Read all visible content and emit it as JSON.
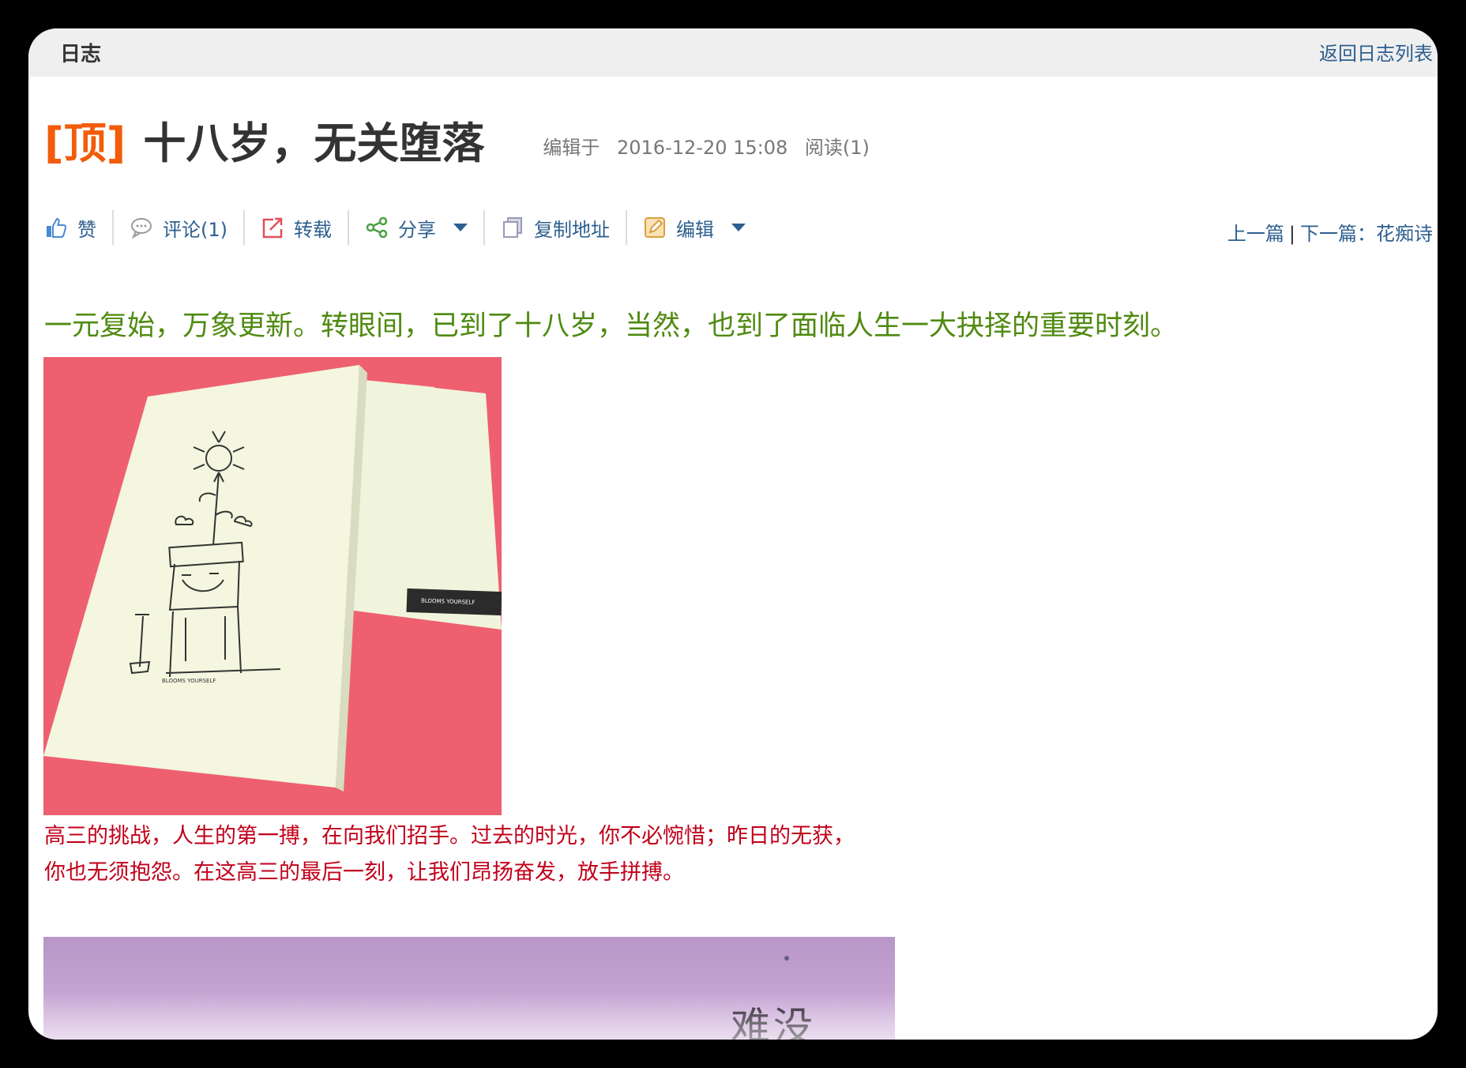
{
  "topbar": {
    "title": "日志",
    "back_link": "返回日志列表"
  },
  "post": {
    "top_tag": "[顶]",
    "title": "十八岁，无关堕落",
    "edited_label": "编辑于",
    "datetime": "2016-12-20 15:08",
    "reads": "阅读(1)"
  },
  "toolbar": {
    "like": "赞",
    "comment": "评论(1)",
    "repost": "转载",
    "share": "分享",
    "copy_link": "复制地址",
    "edit": "编辑"
  },
  "nav": {
    "prev": "上一篇",
    "next": "下一篇：花痴诗"
  },
  "content": {
    "intro": "一元复始，万象更新。转眼间，已到了十八岁，当然，也到了面临人生一大抉择的重要时刻。",
    "card_text": "BLOOMS YOURSELF",
    "caption_line1": "高三的挑战，人生的第一搏，在向我们招手。过去的时光，你不必惋惜；昨日的无获，",
    "caption_line2": "你也无须抱怨。在这高三的最后一刻，让我们昂扬奋发，放手拼搏。",
    "calligraphy": "难没"
  },
  "colors": {
    "link": "#2d5f8f",
    "top_tag": "#f25c0b",
    "intro_green": "#4f8a10",
    "caption_red": "#c0001a",
    "image1_bg": "#ee6070",
    "image2_bg": "#c7a6d4"
  },
  "icons": {
    "like": "thumbs-up-icon",
    "comment": "speech-bubble-icon",
    "repost": "repost-arrow-icon",
    "share": "share-nodes-icon",
    "copy": "copy-pages-icon",
    "edit": "edit-pencil-icon",
    "dropdown": "caret-down-icon"
  }
}
